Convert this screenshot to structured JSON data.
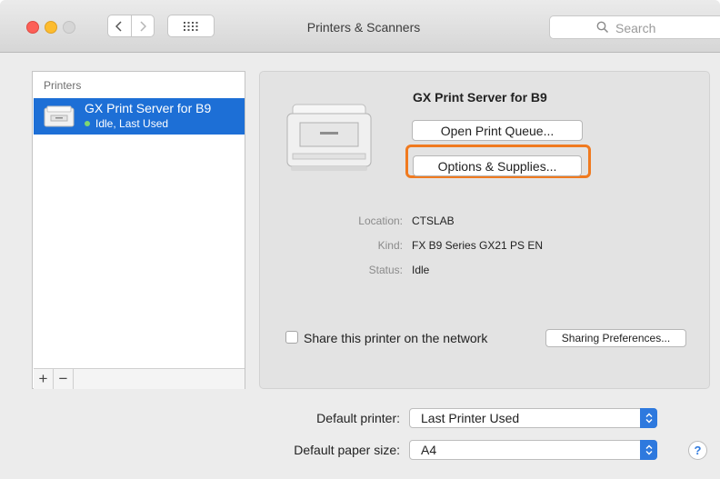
{
  "window": {
    "title": "Printers & Scanners"
  },
  "search": {
    "placeholder": "Search"
  },
  "sidebar": {
    "header": "Printers",
    "printers": [
      {
        "name": "GX Print Server for B9",
        "status": "Idle, Last Used",
        "selected": true
      }
    ],
    "add_label": "+",
    "remove_label": "−"
  },
  "detail": {
    "printer_name": "GX Print Server for B9",
    "open_queue_label": "Open Print Queue...",
    "options_label": "Options & Supplies...",
    "location_label": "Location:",
    "location_value": "CTSLAB",
    "kind_label": "Kind:",
    "kind_value": "FX B9 Series GX21 PS EN",
    "status_label": "Status:",
    "status_value": "Idle",
    "share_label": "Share this printer on the network",
    "share_checked": false,
    "sharing_prefs_label": "Sharing Preferences..."
  },
  "defaults": {
    "default_printer_label": "Default printer:",
    "default_printer_value": "Last Printer Used",
    "paper_size_label": "Default paper size:",
    "paper_size_value": "A4"
  },
  "help_label": "?",
  "colors": {
    "selection": "#1d6fd6",
    "highlight_border": "#f07a1f",
    "popup_arrow": "#2e79de",
    "status_dot": "#7fd672"
  }
}
